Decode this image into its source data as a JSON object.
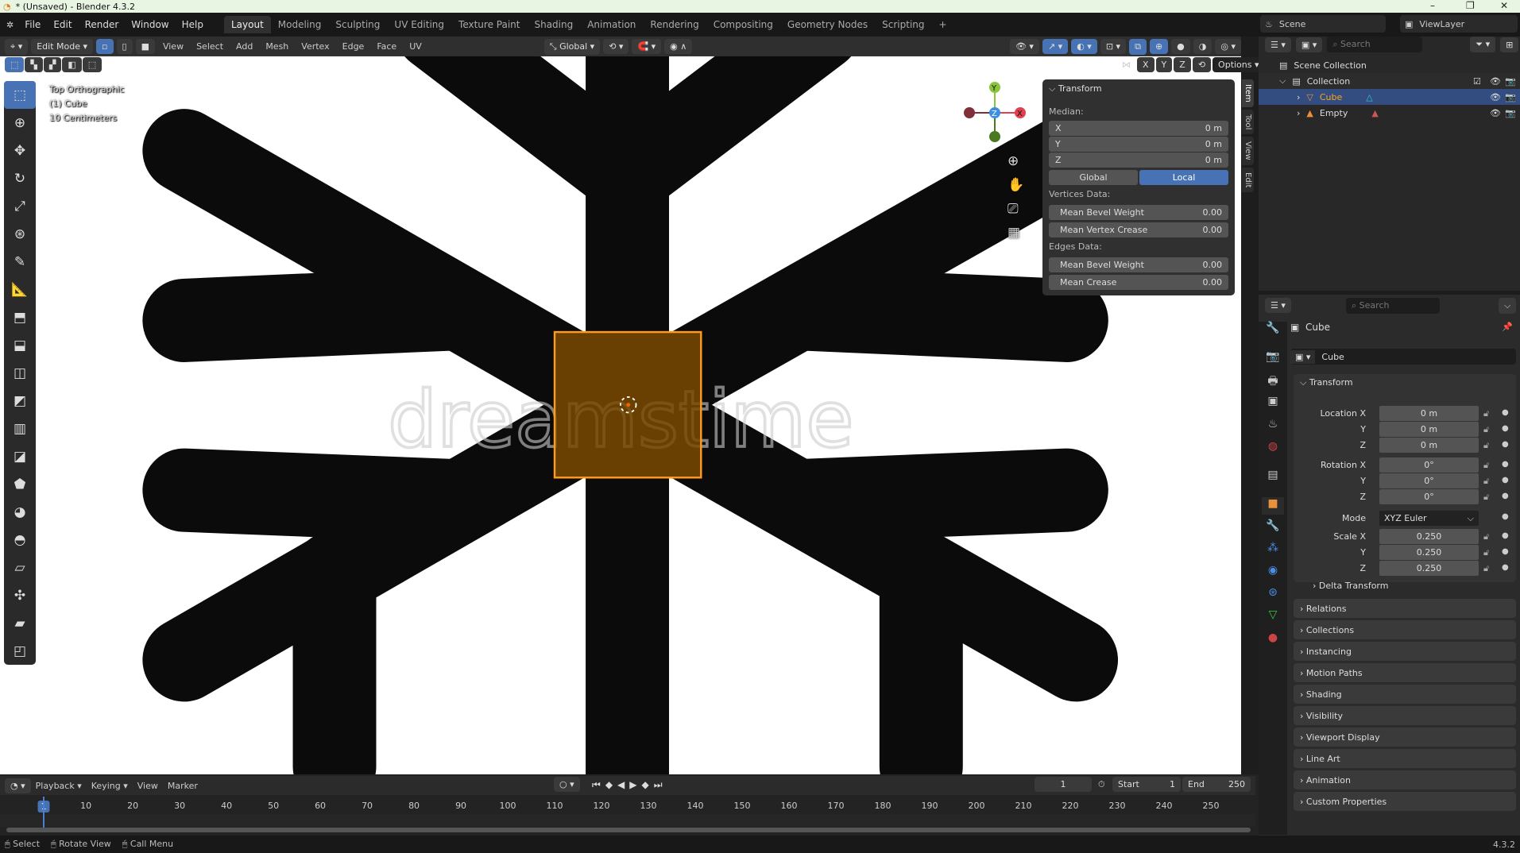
{
  "window": {
    "title": "* (Unsaved) - Blender 4.3.2"
  },
  "menu": {
    "items": [
      "File",
      "Edit",
      "Render",
      "Window",
      "Help"
    ],
    "workspaces": [
      "Layout",
      "Modeling",
      "Sculpting",
      "UV Editing",
      "Texture Paint",
      "Shading",
      "Animation",
      "Rendering",
      "Compositing",
      "Geometry Nodes",
      "Scripting",
      "+"
    ],
    "active_workspace": "Layout",
    "scene": "Scene",
    "view_layer": "ViewLayer"
  },
  "viewport_header": {
    "mode": "Edit Mode",
    "menus": [
      "View",
      "Select",
      "Add",
      "Mesh",
      "Vertex",
      "Edge",
      "Face",
      "UV"
    ],
    "orientation": "Global",
    "options": "Options",
    "axes": [
      "X",
      "Y",
      "Z"
    ]
  },
  "viewport": {
    "overlay": [
      "Top Orthographic",
      "(1) Cube",
      "10 Centimeters"
    ],
    "watermark": "dreamstime",
    "gizmo": [
      "X",
      "Y",
      "Z"
    ],
    "selection_color": "#7a4a00"
  },
  "npanel": {
    "title": "Transform",
    "median_label": "Median:",
    "median": [
      {
        "label": "X",
        "value": "0 m"
      },
      {
        "label": "Y",
        "value": "0 m"
      },
      {
        "label": "Z",
        "value": "0 m"
      }
    ],
    "space": [
      "Global",
      "Local"
    ],
    "active_space": "Local",
    "vertices_label": "Vertices Data:",
    "vertices": [
      {
        "label": "Mean Bevel Weight",
        "value": "0.00"
      },
      {
        "label": "Mean Vertex Crease",
        "value": "0.00"
      }
    ],
    "edges_label": "Edges Data:",
    "edges": [
      {
        "label": "Mean Bevel Weight",
        "value": "0.00"
      },
      {
        "label": "Mean Crease",
        "value": "0.00"
      }
    ],
    "tabs": [
      "Item",
      "Tool",
      "View",
      "Edit"
    ]
  },
  "outliner": {
    "search_placeholder": "Search",
    "scene_collection": "Scene Collection",
    "collection": "Collection",
    "objects": [
      {
        "name": "Cube",
        "selected": true
      },
      {
        "name": "Empty",
        "selected": false
      }
    ]
  },
  "properties": {
    "search_placeholder": "Search",
    "object_name": "Cube",
    "datablock": "Cube",
    "transform_title": "Transform",
    "location": [
      {
        "label": "Location X",
        "value": "0 m"
      },
      {
        "label": "Y",
        "value": "0 m"
      },
      {
        "label": "Z",
        "value": "0 m"
      }
    ],
    "rotation": [
      {
        "label": "Rotation X",
        "value": "0°"
      },
      {
        "label": "Y",
        "value": "0°"
      },
      {
        "label": "Z",
        "value": "0°"
      }
    ],
    "mode_label": "Mode",
    "mode": "XYZ Euler",
    "scale": [
      {
        "label": "Scale X",
        "value": "0.250"
      },
      {
        "label": "Y",
        "value": "0.250"
      },
      {
        "label": "Z",
        "value": "0.250"
      }
    ],
    "delta": "Delta Transform",
    "sections": [
      "Relations",
      "Collections",
      "Instancing",
      "Motion Paths",
      "Shading",
      "Visibility",
      "Viewport Display",
      "Line Art",
      "Animation",
      "Custom Properties"
    ]
  },
  "timeline": {
    "menus": [
      "Playback",
      "Keying",
      "View",
      "Marker"
    ],
    "current_frame": "1",
    "start_label": "Start",
    "start": "1",
    "end_label": "End",
    "end": "250",
    "frames": [
      "1",
      "10",
      "20",
      "30",
      "40",
      "50",
      "60",
      "70",
      "80",
      "90",
      "100",
      "110",
      "120",
      "130",
      "140",
      "150",
      "160",
      "170",
      "180",
      "190",
      "200",
      "210",
      "220",
      "230",
      "240",
      "250"
    ]
  },
  "status": {
    "items": [
      "Select",
      "Rotate View",
      "Call Menu"
    ],
    "version": "4.3.2"
  }
}
